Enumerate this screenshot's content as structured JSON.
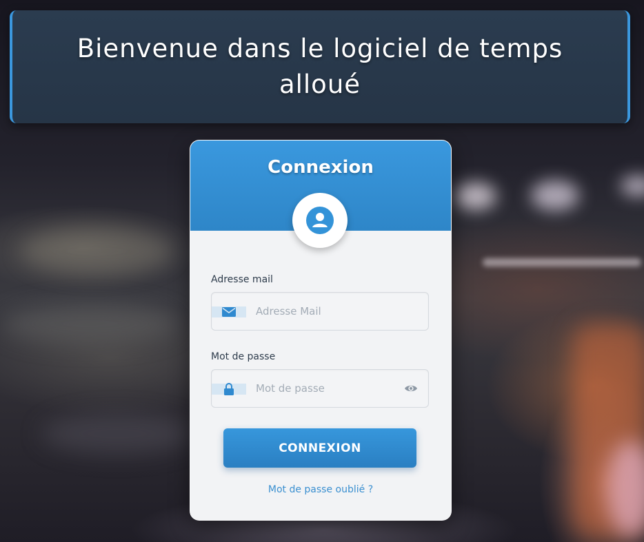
{
  "header": {
    "title": "Bienvenue dans le logiciel de temps alloué"
  },
  "login_card": {
    "title": "Connexion",
    "avatar_icon": "user-circle-icon",
    "email": {
      "label": "Adresse mail",
      "placeholder": "Adresse Mail",
      "value": "",
      "icon": "envelope-icon"
    },
    "password": {
      "label": "Mot de passe",
      "placeholder": "Mot de passe",
      "value": "",
      "icon": "lock-icon",
      "toggle_icon": "eye-icon"
    },
    "submit_label": "CONNEXION",
    "forgot_label": "Mot de passe oublié ?"
  },
  "colors": {
    "accent": "#3a98de",
    "header_bg": "#2c3e52",
    "card_bg": "#f2f3f5",
    "link": "#3a8fd0"
  }
}
